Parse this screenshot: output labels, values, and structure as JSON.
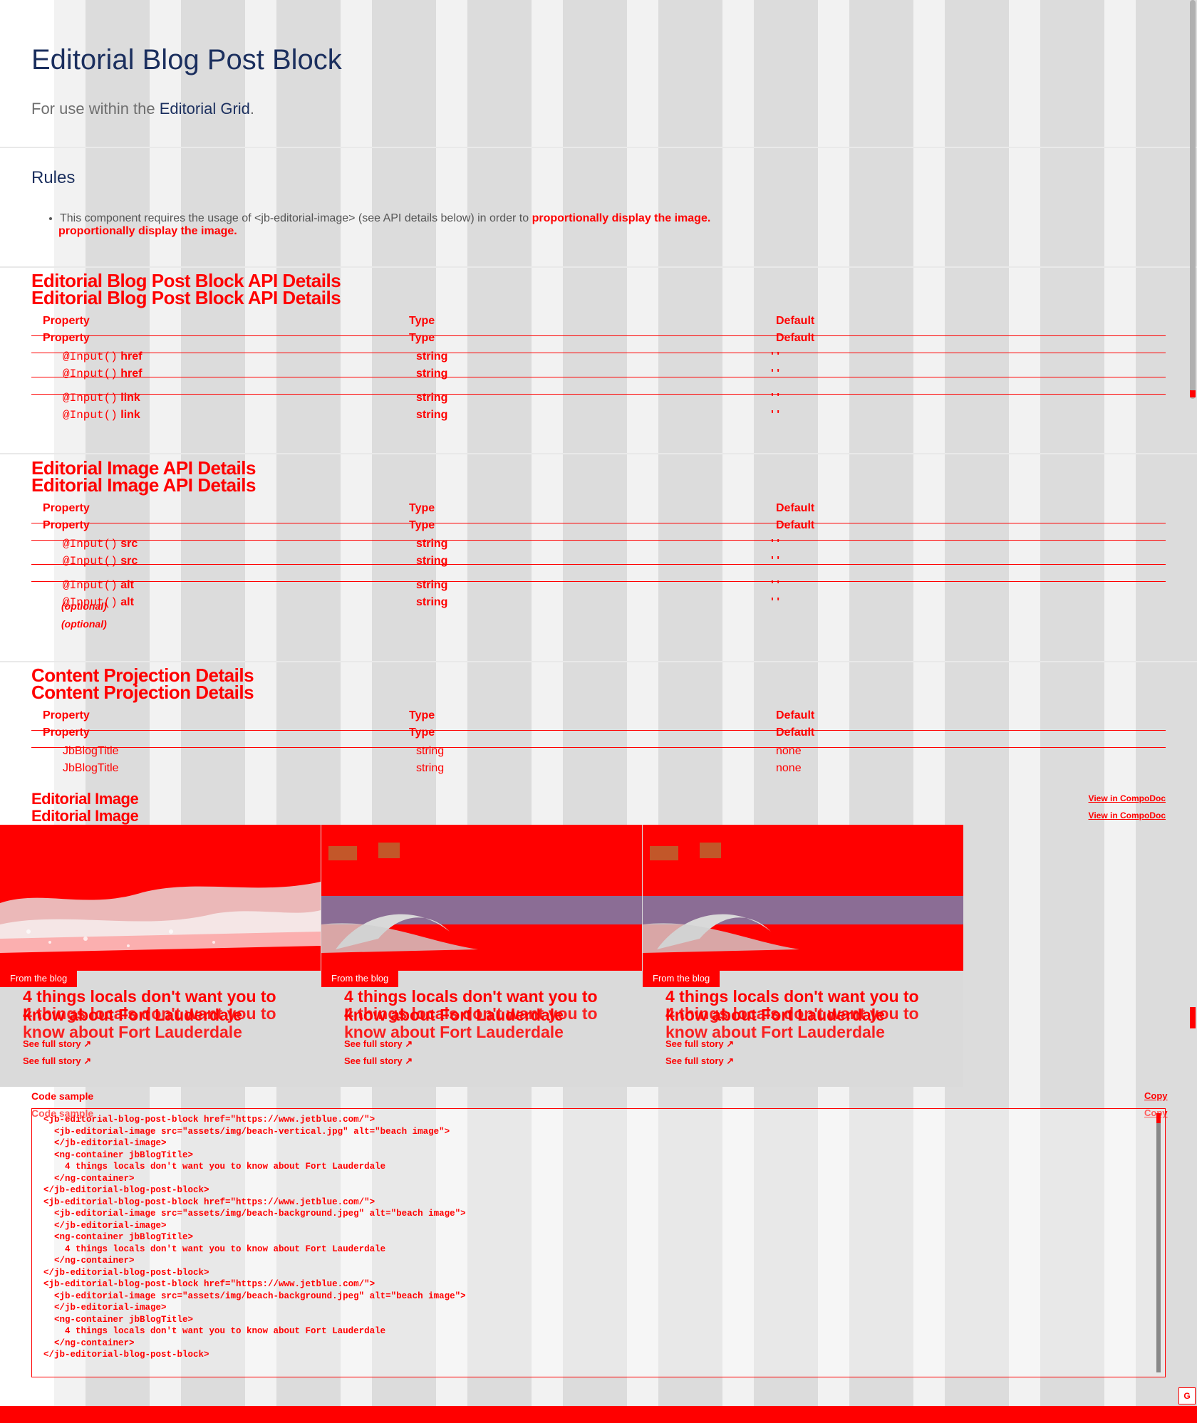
{
  "header": {
    "title": "Editorial Blog Post Block",
    "subtitle_prefix": "For use within the ",
    "subtitle_link": "Editorial Grid",
    "subtitle_suffix": "."
  },
  "rules": {
    "title": "Rules",
    "item_prefix": "This component requires the usage of <jb-editorial-image> (see API details below) in order to ",
    "item_highlight": "proportionally display the image.",
    "item_ghost": "proportionally display the image."
  },
  "blog_api": {
    "title": "Editorial Blog Post Block API Details",
    "headers": {
      "property": "Property",
      "type": "Type",
      "default": "Default"
    },
    "rows": [
      {
        "decorator": "@Input()",
        "name": "href",
        "type": "string",
        "default": "' '"
      },
      {
        "decorator": "@Input()",
        "name": "link",
        "type": "string",
        "default": "' '"
      }
    ]
  },
  "image_api": {
    "title": "Editorial Image API Details",
    "headers": {
      "property": "Property",
      "type": "Type",
      "default": "Default"
    },
    "rows": [
      {
        "decorator": "@Input()",
        "name": "src",
        "type": "string",
        "default": "' '"
      },
      {
        "decorator": "@Input()",
        "name": "alt",
        "type": "string",
        "default": "' '",
        "note": "(optional)"
      }
    ]
  },
  "content_projection": {
    "title": "Content Projection Details",
    "headers": {
      "property": "Property",
      "type": "Type",
      "default": "Default"
    },
    "rows": [
      {
        "name": "JbBlogTitle",
        "type": "string",
        "default": "none"
      }
    ]
  },
  "example": {
    "title": "Editorial Image",
    "compodoc_link": "View in CompoDoc",
    "cards": [
      {
        "badge": "From the blog",
        "title": "4 things locals don't want you to know about Fort Lauderdale",
        "cta": "See full story ↗"
      },
      {
        "badge": "From the blog",
        "title": "4 things locals don't want you to know about Fort Lauderdale",
        "cta": "See full story ↗"
      },
      {
        "badge": "From the blog",
        "title": "4 things locals don't want you to know about Fort Lauderdale",
        "cta": "See full story ↗"
      }
    ]
  },
  "code": {
    "title": "Code sample",
    "copy": "Copy",
    "lines": [
      "<jb-editorial-blog-post-block href=\"https://www.jetblue.com/\">",
      "  <jb-editorial-image src=\"assets/img/beach-vertical.jpg\" alt=\"beach image\">",
      "  </jb-editorial-image>",
      "  <ng-container jbBlogTitle>",
      "    4 things locals don't want you to know about Fort Lauderdale",
      "  </ng-container>",
      "</jb-editorial-blog-post-block>",
      "<jb-editorial-blog-post-block href=\"https://www.jetblue.com/\">",
      "  <jb-editorial-image src=\"assets/img/beach-background.jpeg\" alt=\"beach image\">",
      "  </jb-editorial-image>",
      "  <ng-container jbBlogTitle>",
      "    4 things locals don't want you to know about Fort Lauderdale",
      "  </ng-container>",
      "</jb-editorial-blog-post-block>",
      "<jb-editorial-blog-post-block href=\"https://www.jetblue.com/\">",
      "  <jb-editorial-image src=\"assets/img/beach-background.jpeg\" alt=\"beach image\">",
      "  </jb-editorial-image>",
      "  <ng-container jbBlogTitle>",
      "    4 things locals don't want you to know about Fort Lauderdale",
      "  </ng-container>",
      "</jb-editorial-blog-post-block>"
    ]
  },
  "misc": {
    "corner_badge": "G"
  },
  "colors": {
    "brand_navy": "#1b2f5e",
    "overlay_red": "#ff0000",
    "grid_column": "#dcdcdc"
  }
}
